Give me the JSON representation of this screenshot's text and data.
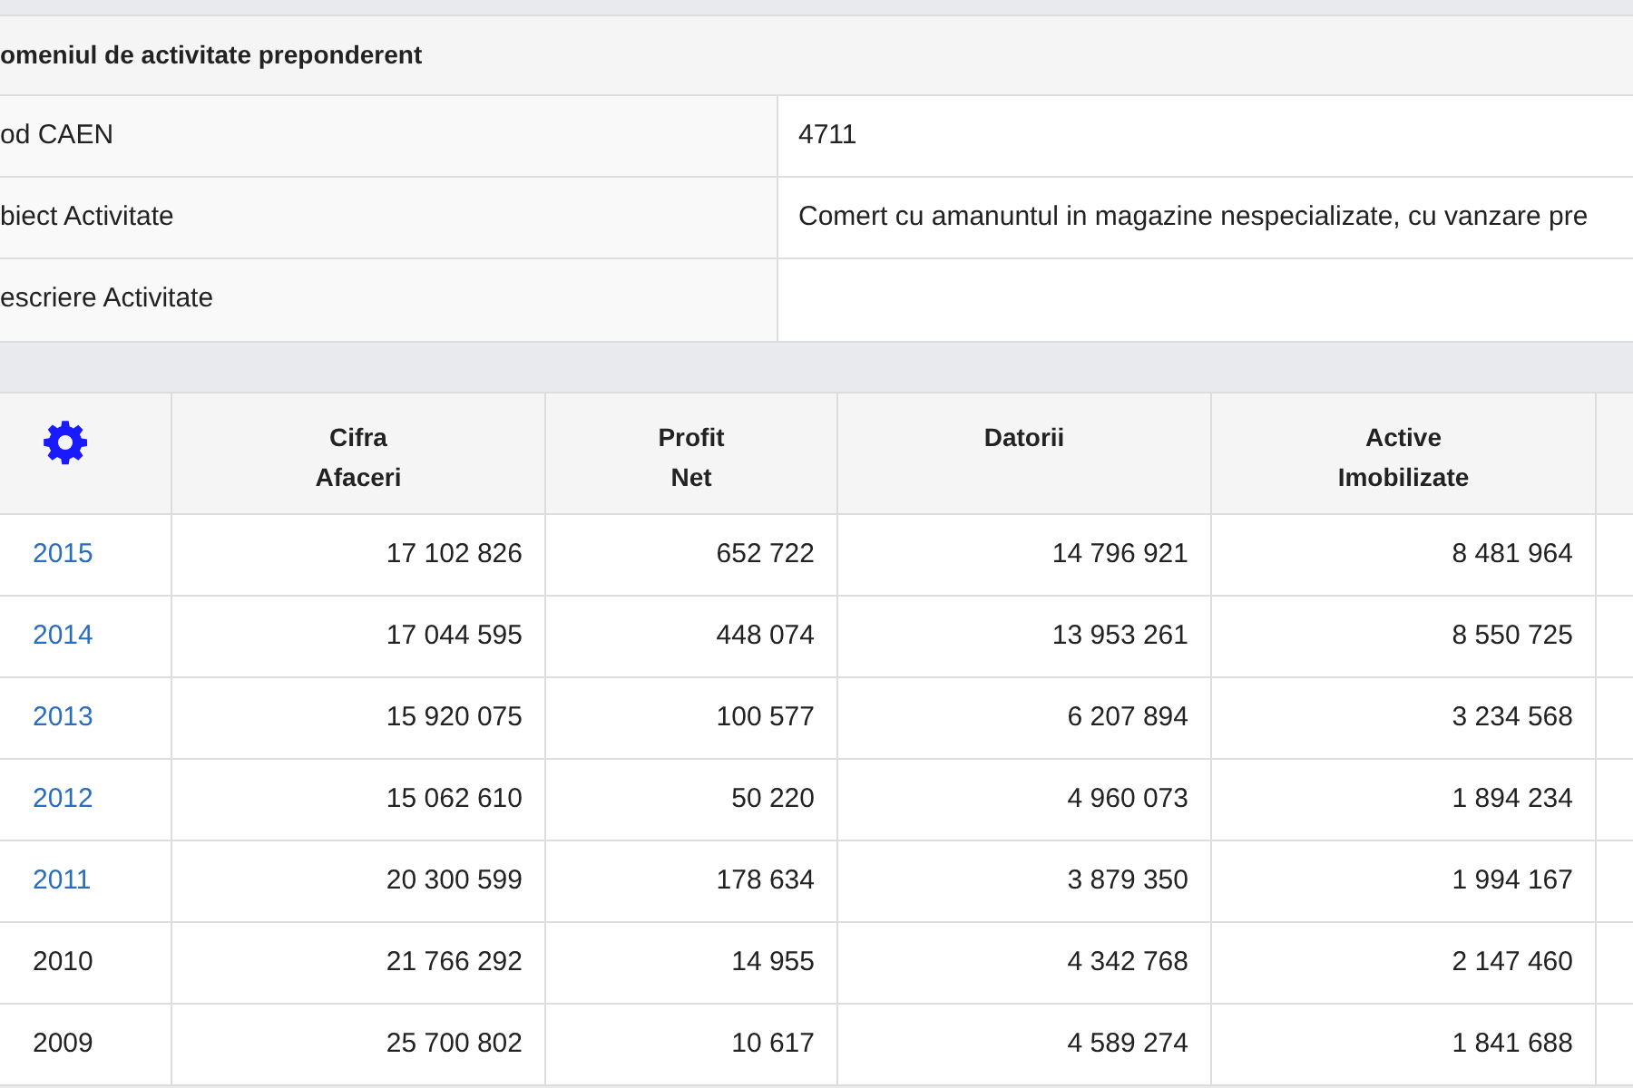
{
  "activity_table": {
    "title": "omeniul de activitate preponderent",
    "rows": [
      {
        "label": "od CAEN",
        "value": "4711"
      },
      {
        "label": "biect Activitate",
        "value": "Comert cu amanuntul in magazine nespecializate, cu vanzare pre"
      },
      {
        "label": "escriere Activitate"
      }
    ]
  },
  "financial_table": {
    "columns": [
      [
        "Cifra",
        "Afaceri"
      ],
      [
        "Profit",
        "Net"
      ],
      [
        "Datorii"
      ],
      [
        "Active",
        "Imobilizate"
      ]
    ],
    "rows": [
      {
        "year": "2015",
        "link": true,
        "values": [
          "17 102 826",
          "652 722",
          "14 796 921",
          "8 481 964"
        ]
      },
      {
        "year": "2014",
        "link": true,
        "values": [
          "17 044 595",
          "448 074",
          "13 953 261",
          "8 550 725"
        ]
      },
      {
        "year": "2013",
        "link": true,
        "values": [
          "15 920 075",
          "100 577",
          "6 207 894",
          "3 234 568"
        ]
      },
      {
        "year": "2012",
        "link": true,
        "values": [
          "15 062 610",
          "50 220",
          "4 960 073",
          "1 894 234"
        ]
      },
      {
        "year": "2011",
        "link": true,
        "values": [
          "20 300 599",
          "178 634",
          "3 879 350",
          "1 994 167"
        ]
      },
      {
        "year": "2010",
        "link": false,
        "values": [
          "21 766 292",
          "14 955",
          "4 342 768",
          "2 147 460"
        ]
      },
      {
        "year": "2009",
        "link": false,
        "values": [
          "25 700 802",
          "10 617",
          "4 589 274",
          "1 841 688"
        ]
      }
    ]
  }
}
